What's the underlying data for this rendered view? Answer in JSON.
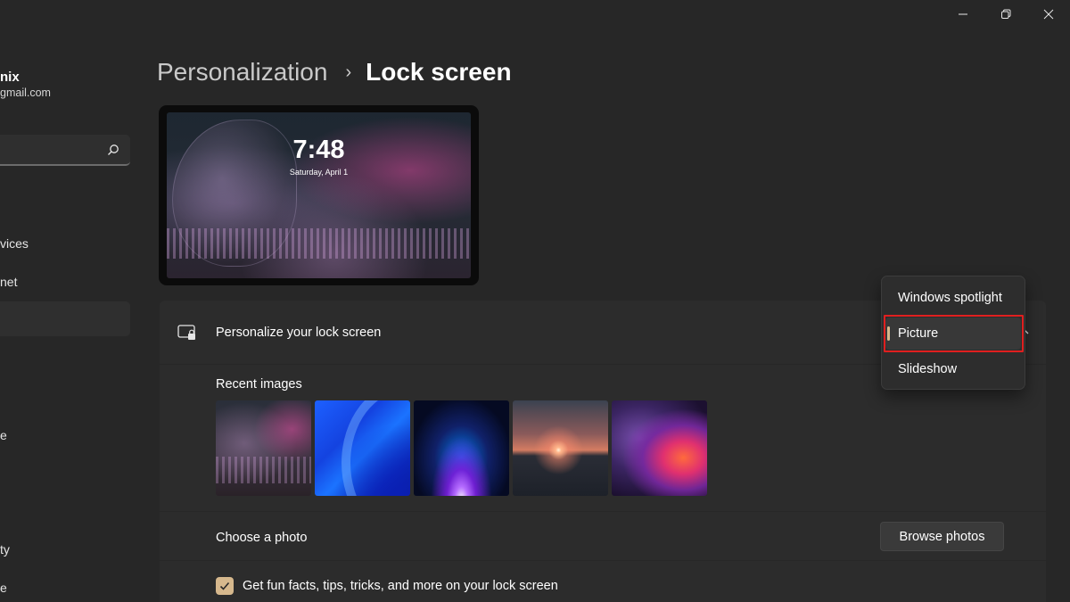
{
  "window": {
    "minimize_icon": "minimize-icon",
    "restore_icon": "restore-icon",
    "close_icon": "close-icon"
  },
  "user": {
    "name": "nix",
    "email": "gmail.com"
  },
  "search": {
    "value": "",
    "placeholder": "",
    "icon": "search-icon"
  },
  "sidebar": {
    "items": [
      {
        "label": "vices"
      },
      {
        "label": "net"
      },
      {
        "label": ""
      },
      {
        "label": "e"
      },
      {
        "label": "ty"
      },
      {
        "label": "e"
      }
    ]
  },
  "breadcrumb": {
    "parent": "Personalization",
    "separator": "›",
    "current": "Lock screen"
  },
  "preview": {
    "time": "7:48",
    "date": "Saturday, April 1"
  },
  "lock_screen": {
    "title": "Personalize your lock screen",
    "icon": "lock-screen-icon",
    "selected": "Picture",
    "options": [
      "Windows spotlight",
      "Picture",
      "Slideshow"
    ]
  },
  "recent_images": {
    "label": "Recent images",
    "count": 5
  },
  "choose_photo": {
    "label": "Choose a photo",
    "button": "Browse photos"
  },
  "tips": {
    "label": "Get fun facts, tips, tricks, and more on your lock screen",
    "checked": true
  },
  "colors": {
    "accent": "#d6b88d",
    "highlight": "#e01f1f",
    "background": "#272727",
    "card": "#2c2c2c"
  }
}
